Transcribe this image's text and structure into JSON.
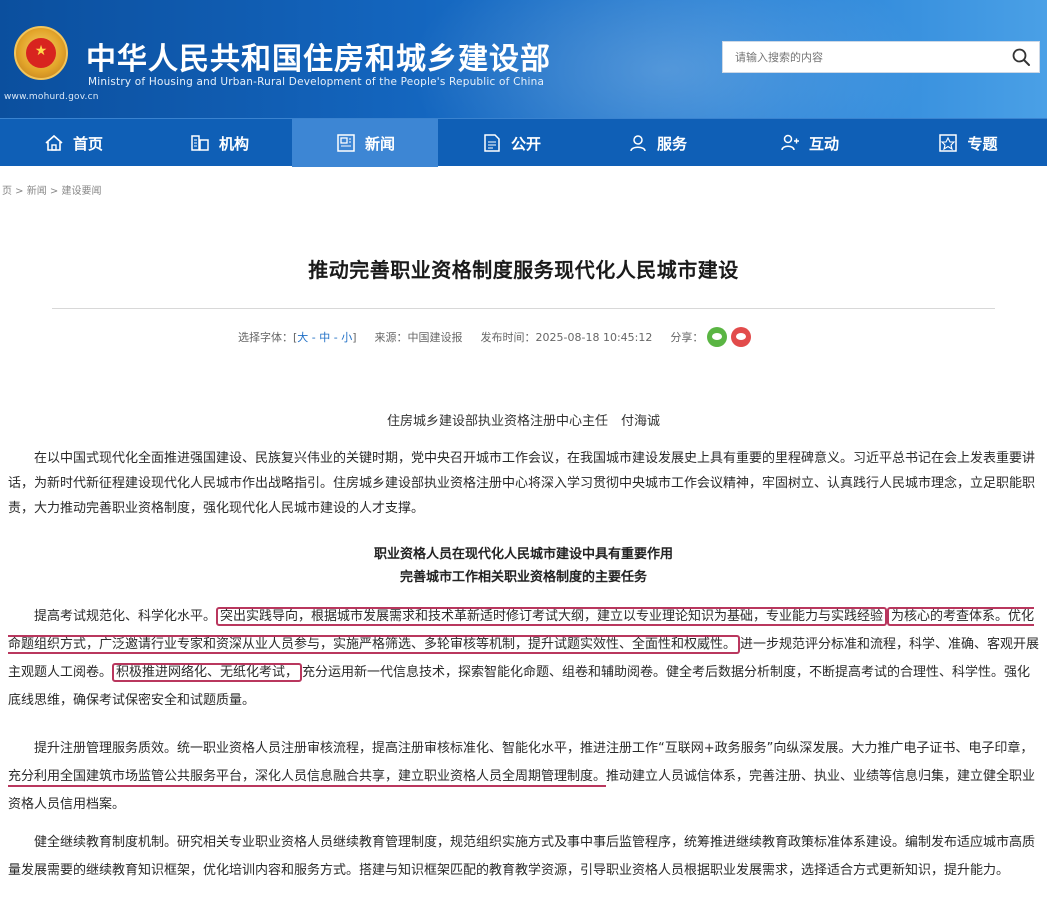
{
  "header": {
    "title_cn": "中华人民共和国住房和城乡建设部",
    "title_en": "Ministry of Housing and Urban-Rural Development of the People's Republic of China",
    "site_url": "www.mohurd.gov.cn",
    "search_placeholder": "请输入搜索的内容",
    "brand_color": "#1466bf"
  },
  "nav": {
    "items": [
      {
        "label": "首页",
        "icon": "home-icon"
      },
      {
        "label": "机构",
        "icon": "building-icon"
      },
      {
        "label": "新闻",
        "icon": "news-icon",
        "active": true
      },
      {
        "label": "公开",
        "icon": "document-icon"
      },
      {
        "label": "服务",
        "icon": "service-icon"
      },
      {
        "label": "互动",
        "icon": "interaction-icon"
      },
      {
        "label": "专题",
        "icon": "topic-icon"
      }
    ]
  },
  "breadcrumb": "页 > 新闻 > 建设要闻",
  "article": {
    "title": "推动完善职业资格制度服务现代化人民城市建设",
    "meta": {
      "font_label": "选择字体：[",
      "font_sizes": "大 - 中 - 小",
      "font_close": "]",
      "source_label": "来源：",
      "source": "中国建设报",
      "date_label": "发布时间：",
      "date": "2025-08-18 10:45:12",
      "share_label": "分享："
    },
    "author": "住房城乡建设部执业资格注册中心主任　付海诚",
    "p1": "在以中国式现代化全面推进强国建设、民族复兴伟业的关键时期，党中央召开城市工作会议，在我国城市建设发展史上具有重要的里程碑意义。习近平总书记在会上发表重要讲话，为新时代新征程建设现代化人民城市作出战略指引。住房城乡建设部执业资格注册中心将深入学习贯彻中央城市工作会议精神，牢固树立、认真践行人民城市理念，立足职能职责，大力推动完善职业资格制度，强化现代化人民城市建设的人才支撑。",
    "subhead1": "职业资格人员在现代化人民城市建设中具有重要作用",
    "subhead2": "完善城市工作相关职业资格制度的主要任务",
    "p2": {
      "a": "提高考试规范化、科学化水平。",
      "b": "突出实践导向，根据城市发展需求和技术革新适时修订考试大纲，建立以专业理论知识为基础，专业能力与实践经验",
      "c": "为核心的考查体系。优化命题组织方式，广泛邀请行业专家和资深从业人员参与，实施严格筛选、多轮审核等机制，提升试题实效性、全面性和权威性。",
      "d": "进一步规范评分标准和流程，科学、准确、客观开展主观题人工阅卷。",
      "e": "积极推进网络化、无纸化考试，",
      "f": "充分运用新一代信息技术，探索智能化命题、组卷和辅助阅卷。健全考后数据分析制度，不断提高考试的合理性、科学性。强化底线思维，确保考试保密安全和试题质量。"
    },
    "p3": {
      "a": "提升注册管理服务质效。统一职业资格人员注册审核流程，提高注册审核标准化、智能化水平，推进注册工作“互联网+政务服务”向纵深发展。大力推广电子证书、电子印章，",
      "b": "充分利用全国建筑市场监管公共服务平台，深化人员信息融合共享，建立职业资格人员全周期管理制度。",
      "c": "推动建立人员诚信体系，完善注册、执业、业绩等信息归集，建立健全职业资格人员信用档案。"
    },
    "p4": "健全继续教育制度机制。研究相关专业职业资格人员继续教育管理制度，规范组织实施方式及事中事后监管程序，统筹推进继续教育政策标准体系建设。编制发布适应城市高质量发展需要的继续教育知识框架，优化培训内容和服务方式。搭建与知识框架匹配的教育教学资源，引导职业资格人员根据职业发展需求，选择适合方式更新知识，提升能力。",
    "highlight_color": "#b9375e"
  }
}
